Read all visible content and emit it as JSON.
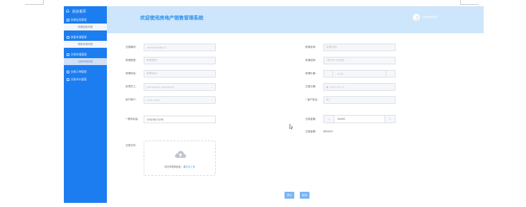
{
  "sidebar": {
    "home_label": "后台首页",
    "groups": [
      {
        "label": "房源信息管理",
        "items": [
          "房源信息列表"
        ]
      },
      {
        "label": "房屋申请管理",
        "items": [
          "看房申请列表"
        ]
      },
      {
        "label": "交易申请管理",
        "items": [
          "交易申请列表"
        ]
      },
      {
        "label": "交易订单管理",
        "items": []
      },
      {
        "label": "交易评价管理",
        "items": []
      }
    ]
  },
  "header": {
    "title": "欢迎使用房地产销售管理系统",
    "username": "yonghu1"
  },
  "form": {
    "order_no": {
      "label": "交易编号:",
      "value": "1684485846022"
    },
    "house_name": {
      "label": "房源名称:",
      "value": "房源名称1"
    },
    "house_type": {
      "label": "房源类型:",
      "value": "房源类型1"
    },
    "house_layout": {
      "label": "房源结构:",
      "value": "1室1厅1卫0阳台"
    },
    "house_address": {
      "label": "房源地址:",
      "value": "房源地址1"
    },
    "house_price": {
      "label": "房源价格:",
      "value": "2000"
    },
    "salesman": {
      "label": "负责员工:",
      "value": "yuangong1-yuangong1"
    },
    "trade_date": {
      "label": "交易日期:",
      "value": "2023-05-19"
    },
    "user_account": {
      "label": "用户账户:",
      "value": "1000-1000"
    },
    "user_name": {
      "label": "客户姓名:",
      "value": "张三",
      "required": "*"
    },
    "contact_phone": {
      "label": "联系电话:",
      "value": "13823823238",
      "required": "*"
    },
    "deal_amount": {
      "label": "交易金额:",
      "value": "18000",
      "minus": "—",
      "plus": "+"
    },
    "trade_total": {
      "label": "交易金额:",
      "value": "880000"
    },
    "file": {
      "label": "交易文件:",
      "hint_prefix": "将文件拖到此处，或",
      "hint_link": "点击上传"
    }
  },
  "actions": {
    "submit": "提交",
    "cancel": "取消"
  }
}
